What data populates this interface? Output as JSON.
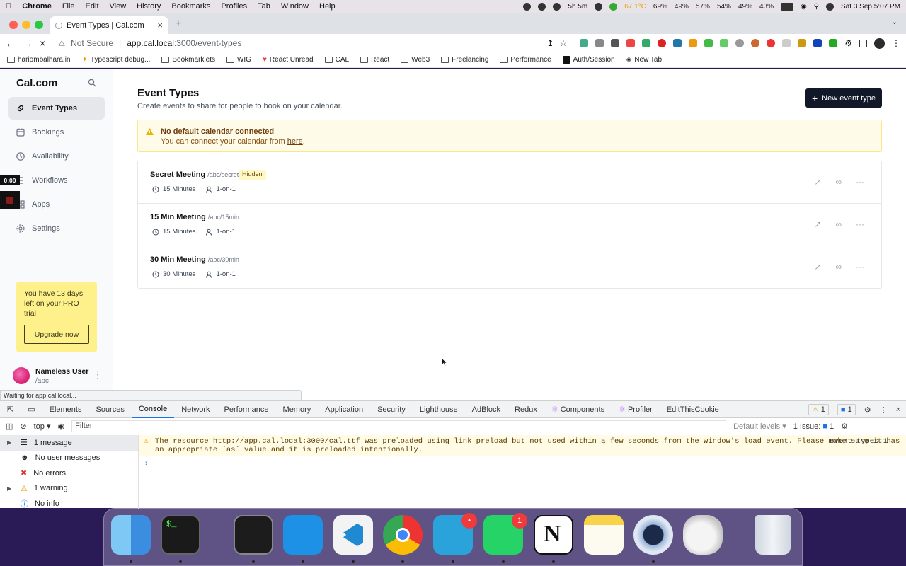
{
  "menubar": {
    "items": [
      "Chrome",
      "File",
      "Edit",
      "View",
      "History",
      "Bookmarks",
      "Profiles",
      "Tab",
      "Window",
      "Help"
    ],
    "timer": "5h 5m",
    "temp": "67.1°C",
    "stats": [
      "69%",
      "49%",
      "57%",
      "54%",
      "49%",
      "43%"
    ],
    "datetime": "Sat 3 Sep  5:07 PM"
  },
  "browser": {
    "tab_title": "Event Types | Cal.com",
    "not_secure": "Not Secure",
    "url_host": "app.cal.local",
    "url_path": ":3000/event-types",
    "bookmarks": [
      "hariombalhara.in",
      "Typescript debug...",
      "Bookmarklets",
      "WIG",
      "React Unread",
      "CAL",
      "React",
      "Web3",
      "Freelancing",
      "Performance",
      "Auth/Session",
      "New Tab"
    ],
    "status_text": "Waiting for app.cal.local..."
  },
  "sidebar": {
    "logo": "Cal.com",
    "items": [
      {
        "label": "Event Types",
        "icon": "link-icon"
      },
      {
        "label": "Bookings",
        "icon": "calendar-icon"
      },
      {
        "label": "Availability",
        "icon": "clock-icon"
      },
      {
        "label": "Workflows",
        "icon": "workflow-icon"
      },
      {
        "label": "Apps",
        "icon": "grid-icon"
      },
      {
        "label": "Settings",
        "icon": "gear-icon"
      }
    ],
    "trial_text": "You have 13 days left on your PRO trial",
    "upgrade_label": "Upgrade now",
    "user_name": "Nameless User",
    "user_slug": "/abc"
  },
  "recorder": {
    "time": "0:00"
  },
  "main": {
    "title": "Event Types",
    "subtitle": "Create events to share for people to book on your calendar.",
    "new_button": "New event type",
    "alert_title": "No default calendar connected",
    "alert_text": "You can connect your calendar from ",
    "alert_link": "here",
    "alert_end": ".",
    "events": [
      {
        "title": "Secret Meeting",
        "slug": "/abc/secret",
        "badge": "Hidden",
        "duration": "15 Minutes",
        "type": "1-on-1"
      },
      {
        "title": "15 Min Meeting",
        "slug": "/abc/15min",
        "badge": "",
        "duration": "15 Minutes",
        "type": "1-on-1"
      },
      {
        "title": "30 Min Meeting",
        "slug": "/abc/30min",
        "badge": "",
        "duration": "30 Minutes",
        "type": "1-on-1"
      }
    ]
  },
  "devtools": {
    "tabs": [
      "Elements",
      "Sources",
      "Console",
      "Network",
      "Performance",
      "Memory",
      "Application",
      "Security",
      "Lighthouse",
      "AdBlock",
      "Redux",
      "Components",
      "Profiler",
      "EditThisCookie"
    ],
    "warn_count": "1",
    "msg_count": "1",
    "context": "top",
    "filter_placeholder": "Filter",
    "levels": "Default levels",
    "issues": "1 Issue:",
    "issues_count": "1",
    "sidebar_items": [
      "1 message",
      "No user messages",
      "No errors",
      "1 warning",
      "No info"
    ],
    "warning_pre": "The resource ",
    "warning_url": "http://app.cal.local:3000/cal.ttf",
    "warning_post": " was preloaded using link preload but not used within a few seconds from the window's load event. Please make sure it has an appropriate `as` value and it is preloaded intentionally.",
    "warning_source": "event-types:1",
    "prompt": "›"
  },
  "dock": {
    "apps": [
      "finder",
      "terminal",
      "activity-monitor",
      "docker",
      "vscode",
      "chrome",
      "telegram",
      "whatsapp",
      "notion",
      "notes",
      "1password",
      "script-editor",
      "trash"
    ],
    "telegram_badge": "•",
    "whatsapp_badge": "1"
  }
}
